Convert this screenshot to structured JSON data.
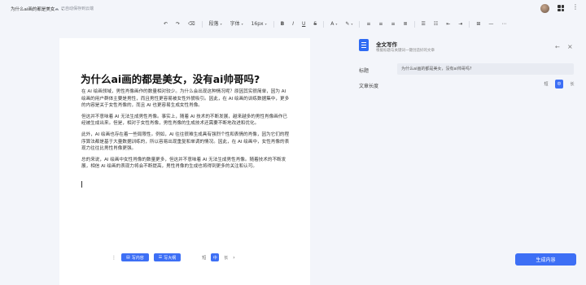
{
  "header": {
    "doc_title": "为什么ai画的都是美女...",
    "doc_title_caret": "▾",
    "save_status": "已自动保存到云端"
  },
  "toolbar": {
    "items": [
      {
        "label": "↶",
        "name": "undo-button"
      },
      {
        "label": "↷",
        "name": "redo-button"
      },
      {
        "label": "⌫",
        "name": "clear-format-button"
      },
      {
        "label": "段落",
        "name": "paragraph-select",
        "caret": true
      },
      {
        "label": "字体",
        "name": "font-family-select",
        "caret": true
      },
      {
        "label": "16px",
        "name": "font-size-select",
        "caret": true
      },
      {
        "label": "B",
        "name": "bold-button"
      },
      {
        "label": "I",
        "name": "italic-button"
      },
      {
        "label": "U",
        "name": "underline-button"
      },
      {
        "label": "S",
        "name": "strikethrough-button"
      },
      {
        "label": "A",
        "name": "font-color-button",
        "caret": true
      },
      {
        "label": "✎",
        "name": "highlight-button",
        "caret": true
      },
      {
        "label": "≡",
        "name": "align-left-button"
      },
      {
        "label": "≡",
        "name": "align-center-button"
      },
      {
        "label": "≡",
        "name": "align-right-button"
      },
      {
        "label": "≣",
        "name": "justify-button"
      },
      {
        "label": "☰",
        "name": "bullet-list-button"
      },
      {
        "label": "☷",
        "name": "numbered-list-button"
      },
      {
        "label": "⇤",
        "name": "outdent-button"
      },
      {
        "label": "⇥",
        "name": "indent-button"
      },
      {
        "label": "⊞",
        "name": "insert-table-button"
      },
      {
        "label": "—",
        "name": "divider-button"
      },
      {
        "label": "⋯",
        "name": "more-button"
      }
    ]
  },
  "document": {
    "heading": "为什么ai画的都是美女，没有ai帅哥吗?",
    "paragraphs": [
      "在 AI 绘画领域，男性肖像画作的数量相对较少。为什么会出现这种情况呢？原因其实很简单，因为 AI 绘画的用户群体主要是男性，而且男性更容易被女性外貌吸引。因此，在 AI 绘画的训练数据集中，更多的内容是关于女性肖像的，而且 AI 也更容易生成女性肖像。",
      "但这并不意味着 AI 无法生成男性肖像。事实上，随着 AI 技术的不断发展，越来越多的男性肖像画作已经被生成出来。但是，相对于女性肖像，男性肖像的生成技术还需要不断地改进和优化。",
      "此外，AI 绘画也存在着一些局限性。例如，AI 往往很难生成具有强烈个性和表情的肖像，因为它们的程序算法都是基于大量数据训练的，所以容易出现重复和单调的情况。因此，在 AI 绘画中，女性肖像的表现力往往比男性肖像更强。",
      "总的来说，AI 绘画中女性肖像的数量更多，但这并不意味着 AI 无法生成男性肖像。随着技术的不断发展，相信 AI 绘画的表现力将会不断提高，男性肖像的生成也将得到更多的关注和认可。"
    ]
  },
  "bottom_bar": {
    "dots": "⋮",
    "continue_label": "写内容",
    "outline_label": "写大纲",
    "length_options": [
      "短",
      "中",
      "长"
    ],
    "active_length": "中",
    "next": "›"
  },
  "panel": {
    "title": "全文写作",
    "subtitle": "根据标题与关键词一键创造好的文章",
    "back": "←",
    "close": "×",
    "title_label": "标题",
    "title_value": "为什么ai画的都是美女，没有ai帅哥吗?",
    "length_label": "文章长度",
    "length_options": [
      "短",
      "中",
      "长"
    ],
    "active_length": "中",
    "generate_label": "生成内容"
  }
}
